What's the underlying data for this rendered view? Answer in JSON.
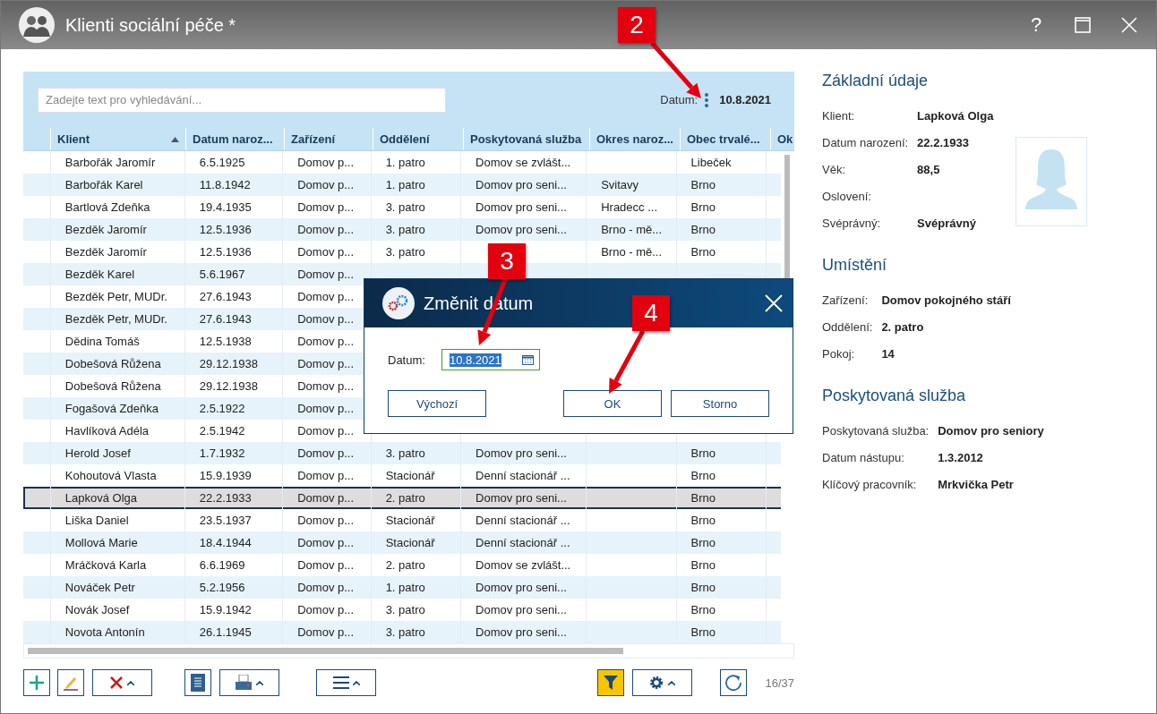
{
  "window": {
    "title": "Klienti sociální péče *",
    "help": "?"
  },
  "search": {
    "placeholder": "Zadejte text pro vyhledávání..."
  },
  "date_bar": {
    "label": "Datum:",
    "value": "10.8.2021"
  },
  "table": {
    "columns": [
      {
        "label": "Klient",
        "sorted": true
      },
      {
        "label": "Datum naroz...",
        "sorted": false
      },
      {
        "label": "Zařízení",
        "sorted": false
      },
      {
        "label": "Oddělení",
        "sorted": false
      },
      {
        "label": "Poskytovaná služba",
        "sorted": false
      },
      {
        "label": "Okres naroz...",
        "sorted": false
      },
      {
        "label": "Obec trvalé...",
        "sorted": false
      },
      {
        "label": "Ok",
        "sorted": false
      }
    ],
    "rows": [
      {
        "selected": false,
        "cells": [
          "Barbořák Jaromír",
          "6.5.1925",
          "Domov p...",
          "1. patro",
          "Domov se zvlášt...",
          "",
          "Libeček"
        ]
      },
      {
        "selected": false,
        "cells": [
          "Barbořák Karel",
          "11.8.1942",
          "Domov p...",
          "1. patro",
          "Domov pro seni...",
          "Svitavy",
          "Brno"
        ]
      },
      {
        "selected": false,
        "cells": [
          "Bartlová Zdeňka",
          "19.4.1935",
          "Domov p...",
          "3. patro",
          "Domov pro seni...",
          "Hradecc ...",
          "Brno"
        ]
      },
      {
        "selected": false,
        "cells": [
          "Bezděk Jaromír",
          "12.5.1936",
          "Domov p...",
          "3. patro",
          "Domov pro seni...",
          "Brno - mě...",
          "Brno"
        ]
      },
      {
        "selected": false,
        "cells": [
          "Bezděk Jaromír",
          "12.5.1936",
          "Domov p...",
          "3. patro",
          null,
          "Brno - mě...",
          "Brno"
        ]
      },
      {
        "selected": false,
        "cells": [
          "Bezděk Karel",
          "5.6.1967",
          "Domov p..."
        ]
      },
      {
        "selected": false,
        "cells": [
          "Bezděk Petr, MUDr.",
          "27.6.1943",
          "Domov p..."
        ]
      },
      {
        "selected": false,
        "cells": [
          "Bezděk Petr, MUDr.",
          "27.6.1943",
          "Domov p..."
        ]
      },
      {
        "selected": false,
        "cells": [
          "Dědina Tomáš",
          "12.5.1938",
          "Domov p..."
        ]
      },
      {
        "selected": false,
        "cells": [
          "Dobešová Růžena",
          "29.12.1938",
          "Domov p..."
        ]
      },
      {
        "selected": false,
        "cells": [
          "Dobešová Růžena",
          "29.12.1938",
          "Domov p..."
        ]
      },
      {
        "selected": false,
        "cells": [
          "Fogašová Zdeňka",
          "2.5.1922",
          "Domov p..."
        ]
      },
      {
        "selected": false,
        "cells": [
          "Havlíková Adéla",
          "2.5.1942",
          "Domov p..."
        ]
      },
      {
        "selected": false,
        "cells": [
          "Herold Josef",
          "1.7.1932",
          "Domov p...",
          "3. patro",
          "Domov pro seni...",
          "",
          "Brno"
        ]
      },
      {
        "selected": false,
        "cells": [
          "Kohoutová Vlasta",
          "15.9.1939",
          "Domov p...",
          "Stacionář",
          "Denní stacionář ...",
          "",
          "Brno"
        ]
      },
      {
        "selected": true,
        "cells": [
          "Lapková Olga",
          "22.2.1933",
          "Domov p...",
          "2. patro",
          "Domov pro seni...",
          "",
          "Brno"
        ]
      },
      {
        "selected": false,
        "cells": [
          "Liška Daniel",
          "23.5.1937",
          "Domov p...",
          "Stacionář",
          "Denní stacionář ...",
          "",
          "Brno"
        ]
      },
      {
        "selected": false,
        "cells": [
          "Mollová Marie",
          "18.4.1944",
          "Domov p...",
          "Stacionář",
          "Denní stacionář ...",
          "",
          "Brno"
        ]
      },
      {
        "selected": false,
        "cells": [
          "Mráčková Karla",
          "6.6.1969",
          "Domov p...",
          "2. patro",
          "Domov se zvlášt...",
          "",
          "Brno"
        ]
      },
      {
        "selected": false,
        "cells": [
          "Nováček Petr",
          "5.2.1956",
          "Domov p...",
          "1. patro",
          "Domov pro seni...",
          "",
          "Brno"
        ]
      },
      {
        "selected": false,
        "cells": [
          "Novák Josef",
          "15.9.1942",
          "Domov p...",
          "3. patro",
          "Domov pro seni...",
          "",
          "Brno"
        ]
      },
      {
        "selected": false,
        "cells": [
          "Novota Antonín",
          "26.1.1945",
          "Domov p...",
          "3. patro",
          "Domov pro seni...",
          "",
          "Brno"
        ]
      }
    ]
  },
  "toolbar": [
    {
      "kind": "add",
      "dropdown": false,
      "on": false
    },
    {
      "kind": "edit",
      "dropdown": false,
      "on": false
    },
    {
      "kind": "delete",
      "dropdown": true,
      "on": false
    },
    {
      "kind": "document",
      "dropdown": false,
      "on": false
    },
    {
      "kind": "print",
      "dropdown": true,
      "on": false
    },
    {
      "kind": "menu",
      "dropdown": true,
      "on": false
    },
    {
      "kind": "filter",
      "dropdown": false,
      "on": true
    },
    {
      "kind": "settings",
      "dropdown": true,
      "on": false
    },
    {
      "kind": "refresh",
      "dropdown": false,
      "on": false
    }
  ],
  "record_count": "16/37",
  "detail": {
    "sections": [
      {
        "title": "Základní údaje",
        "fields": [
          {
            "label": "Klient:",
            "value": "Lapková Olga"
          },
          {
            "label": "Datum narození:",
            "value": "22.2.1933"
          },
          {
            "label": "Věk:",
            "value": "88,5"
          },
          {
            "label": "Oslovení:"
          },
          {
            "label": "Svéprávný:",
            "value": "Svéprávný"
          }
        ]
      },
      {
        "title": "Umístění",
        "fields": [
          {
            "label": "Zařízení:",
            "value": "Domov pokojného stáří"
          },
          {
            "label": "Oddělení:",
            "value": "2. patro"
          },
          {
            "label": "Pokoj:",
            "value": "14"
          }
        ]
      },
      {
        "title": "Poskytovaná služba",
        "fields": [
          {
            "label": "Poskytovaná služba:",
            "value": "Domov pro seniory"
          },
          {
            "label": "Datum nástupu:",
            "value": "1.3.2012"
          },
          {
            "label": "Klíčový pracovník:",
            "value": "Mrkvička Petr"
          }
        ]
      }
    ]
  },
  "dialog": {
    "title": "Změnit datum",
    "field_label": "Datum:",
    "field_value": "10.8.2021",
    "buttons": [
      "Výchozí",
      "OK",
      "Storno"
    ]
  },
  "callouts": [
    {
      "number": "2"
    },
    {
      "number": "3"
    },
    {
      "number": "4"
    }
  ]
}
